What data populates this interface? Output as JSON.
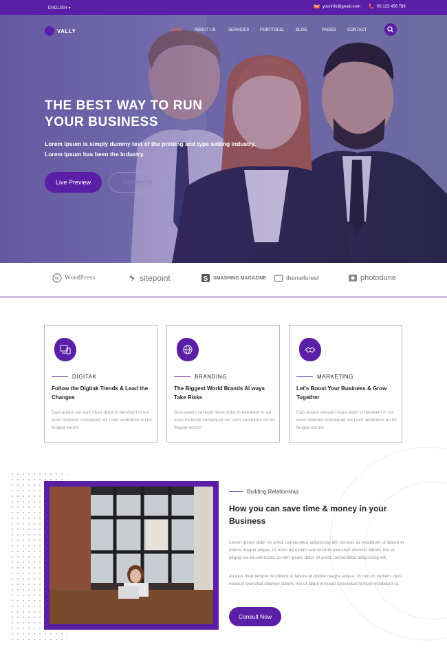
{
  "topbar": {
    "language": "ENGLISH",
    "email": "yourinfo@gmail.com",
    "phone": "00 123 456 789"
  },
  "nav": {
    "logo_text": "VALLY",
    "items": [
      "HOME",
      "ABOUT US",
      "SERVICES",
      "PORTFOLIO",
      "BLOG",
      "PAGES",
      "CONTACT"
    ],
    "active_color": "#ff6a3d"
  },
  "hero": {
    "title_line1": "THE BEST WAY TO RUN",
    "title_line2": "YOUR BUSINESS",
    "subtitle": "Lorem Ipsum is simply dummy text of the printing and type setting industry. Lorem Ipsum has been the industry.",
    "primary_button": "Live Preview",
    "secondary_button": "Contact Us"
  },
  "clients": [
    "WordPress",
    "sitepoint",
    "SMASHING MAGAZINE",
    "themeforest",
    "photodune"
  ],
  "services": [
    {
      "tag": "DIGITAK",
      "title": "Follow the Digitak Trends & Lead the Changes",
      "desc": "Duis autem vel eum iriure dolor in hendrerit in vul esse molestie consequat vel Lium veridolore eu fer feugiat eorum",
      "icon": "devices-icon"
    },
    {
      "tag": "BRANDING",
      "title": "The Biggest World Brands Al ways Take Risks",
      "desc": "Duis autem vel eum iriure dolor in hendrerit in vul esse molestie consequat vel Lium veridolore eu fer feugiat eorum",
      "icon": "globe-icon"
    },
    {
      "tag": "MARKETING",
      "title": "Let's Boost Your Business & Grow Together",
      "desc": "Duis autem vel eum iriure dolor in hendrerit in vul esse molestie consequat vel Lium veridolore eu fer feugiat eorum",
      "icon": "handshake-icon"
    }
  ],
  "about": {
    "tag": "Building Relationship",
    "title": "How you can save time & money in your Business",
    "para1": "Lorem ipsum dolor sit amet, consectetur adipisicing elit, do eius as incididunt ut labore et dolore magna aliqua. Ut enim ad minim ven nostrud exercitati ullamco laboris nisi ut aliquip ex ea commodo co rem ipsum dolor sit amet, consectetur adipisicing elit.",
    "para2": "do eius mod tempor incididunt ut labore et dolore magna aliqua. Ut min im veniam, quis nostrud exercitati ullamco laboris nisi ut aliqui immodo consequat tempor incididunt ut.",
    "button": "Consult Now"
  },
  "colors": {
    "brand": "#5a1fa6",
    "accent": "#ff6a3d",
    "card_border": "#b9aee0"
  }
}
